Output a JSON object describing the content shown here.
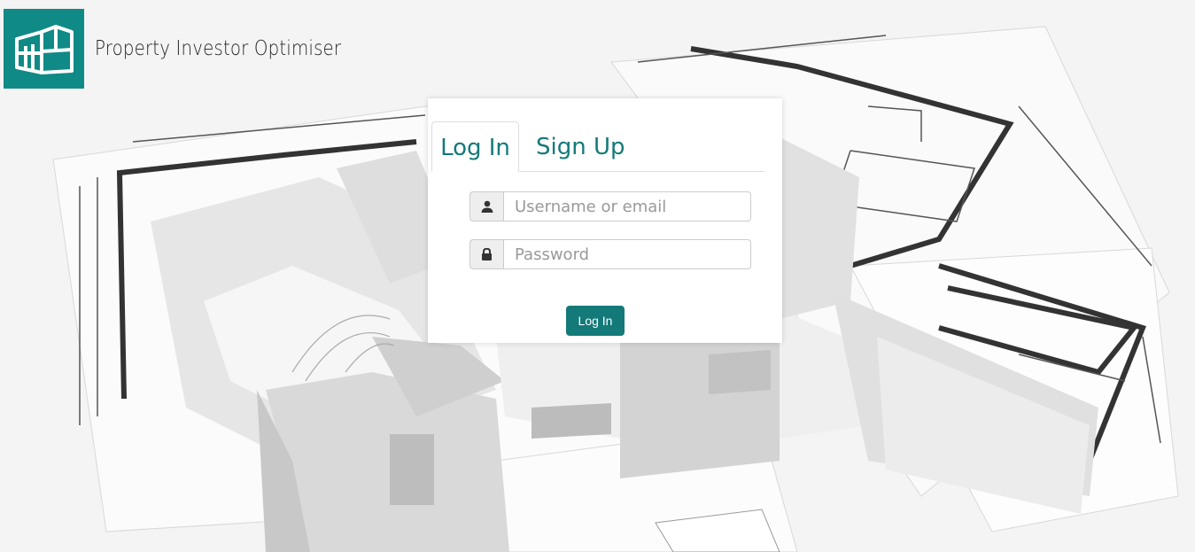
{
  "app": {
    "title": "Property Investor Optimiser"
  },
  "colors": {
    "brand": "#0f8a86",
    "accent": "#137a79"
  },
  "auth": {
    "tabs": [
      {
        "label": "Log In",
        "active": true
      },
      {
        "label": "Sign Up",
        "active": false
      }
    ],
    "username": {
      "placeholder": "Username or email",
      "icon": "user-icon"
    },
    "password": {
      "placeholder": "Password",
      "icon": "lock-icon"
    },
    "submit_label": "Log In"
  },
  "background": {
    "icon": "architectural-blueprint-illustration"
  }
}
